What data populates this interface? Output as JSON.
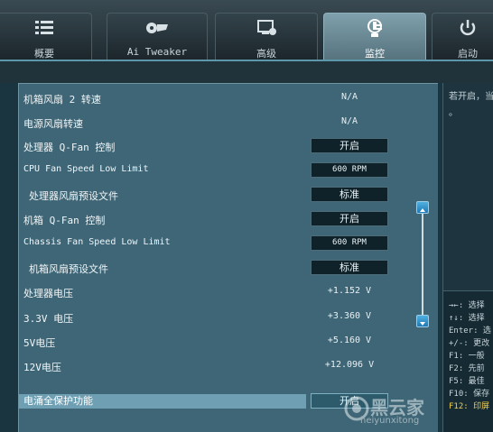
{
  "nav": {
    "tabs": [
      {
        "label": "概要",
        "icon": "list-icon",
        "active": false
      },
      {
        "label": "Ai Tweaker",
        "icon": "tweaker-icon",
        "active": false
      },
      {
        "label": "高级",
        "icon": "advanced-icon",
        "active": false
      },
      {
        "label": "监控",
        "icon": "monitor-icon",
        "active": true
      },
      {
        "label": "启动",
        "icon": "power-icon",
        "active": false
      }
    ]
  },
  "settings": [
    {
      "label": "机箱风扇 2 转速",
      "value": "N/A",
      "type": "value"
    },
    {
      "label": "电源风扇转速",
      "value": "N/A",
      "type": "value"
    },
    {
      "label": "处理器 Q-Fan 控制",
      "value": "开启",
      "type": "button"
    },
    {
      "label": "CPU Fan Speed Low Limit",
      "value": "600 RPM",
      "type": "button"
    },
    {
      "label": "处理器风扇预设文件",
      "value": "标准",
      "type": "button"
    },
    {
      "label": "机箱 Q-Fan 控制",
      "value": "开启",
      "type": "button"
    },
    {
      "label": "Chassis Fan Speed Low Limit",
      "value": "600 RPM",
      "type": "button"
    },
    {
      "label": "机箱风扇预设文件",
      "value": "标准",
      "type": "button"
    },
    {
      "label": "处理器电压",
      "value": "+1.152 V",
      "type": "value"
    },
    {
      "label": "3.3V 电压",
      "value": "+3.360 V",
      "type": "value"
    },
    {
      "label": "5V电压",
      "value": "+5.160 V",
      "type": "value"
    },
    {
      "label": "12V电压",
      "value": "+12.096 V",
      "type": "value"
    },
    {
      "label": "电涌全保护功能",
      "value": "开启",
      "type": "button"
    }
  ],
  "right": {
    "desc_line1": "若开启，当",
    "desc_line2": "。"
  },
  "help": [
    {
      "text": "→←: 选择",
      "yellow": false
    },
    {
      "text": "↑↓: 选择",
      "yellow": false
    },
    {
      "text": "Enter: 选",
      "yellow": false
    },
    {
      "text": "+/-: 更改",
      "yellow": false
    },
    {
      "text": "F1: 一般",
      "yellow": false
    },
    {
      "text": "F2: 先前",
      "yellow": false
    },
    {
      "text": "F5: 最佳",
      "yellow": false
    },
    {
      "text": "F10: 保存",
      "yellow": false
    },
    {
      "text": "F12: 印屏",
      "yellow": true
    }
  ],
  "watermark": {
    "name": "黑云家",
    "url": "heiyunxitong"
  }
}
